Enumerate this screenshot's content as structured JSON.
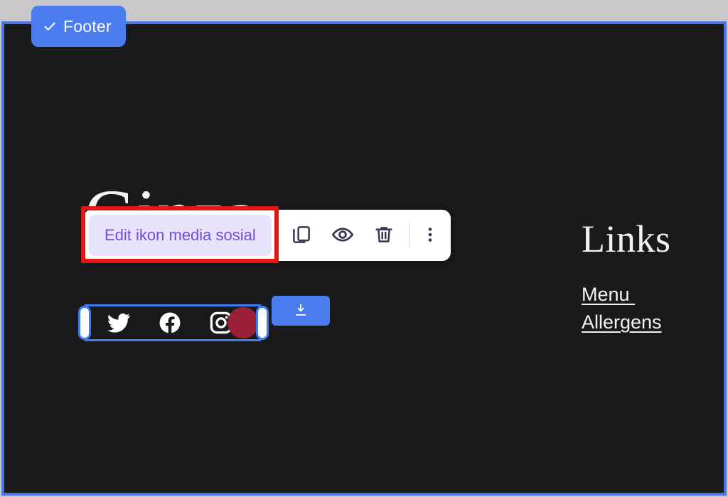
{
  "section": {
    "badge_label": "Footer",
    "badge_icon": "check-icon",
    "badge_color": "#4a7cf0",
    "outline_color": "#4a74e8",
    "background_color": "#1a1a1c"
  },
  "footer_content": {
    "brand_wordmark": "Ginza",
    "links_heading": "Links",
    "links": [
      {
        "label": "Menu "
      },
      {
        "label": "Allergens"
      }
    ]
  },
  "social_block": {
    "icons": [
      {
        "name": "twitter-icon",
        "label": "Twitter"
      },
      {
        "name": "facebook-icon",
        "label": "Facebook"
      },
      {
        "name": "instagram-icon",
        "label": "Instagram"
      }
    ],
    "selection_color": "#3d7bf7",
    "blob_color": "#9c1f38"
  },
  "download_button": {
    "icon": "download-icon",
    "color": "#4a7cf0"
  },
  "element_toolbar": {
    "edit_label": "Edit ikon media sosial",
    "edit_bg": "#e8e2fb",
    "edit_fg": "#6c4ee0",
    "actions": [
      {
        "name": "duplicate-icon",
        "label": "Duplicate"
      },
      {
        "name": "eye-icon",
        "label": "Hide"
      },
      {
        "name": "trash-icon",
        "label": "Delete"
      },
      {
        "name": "more-vertical-icon",
        "label": "More options"
      }
    ]
  },
  "annotation": {
    "highlight_color": "#e81515",
    "target": "edit-ikon-media-sosial-button"
  }
}
